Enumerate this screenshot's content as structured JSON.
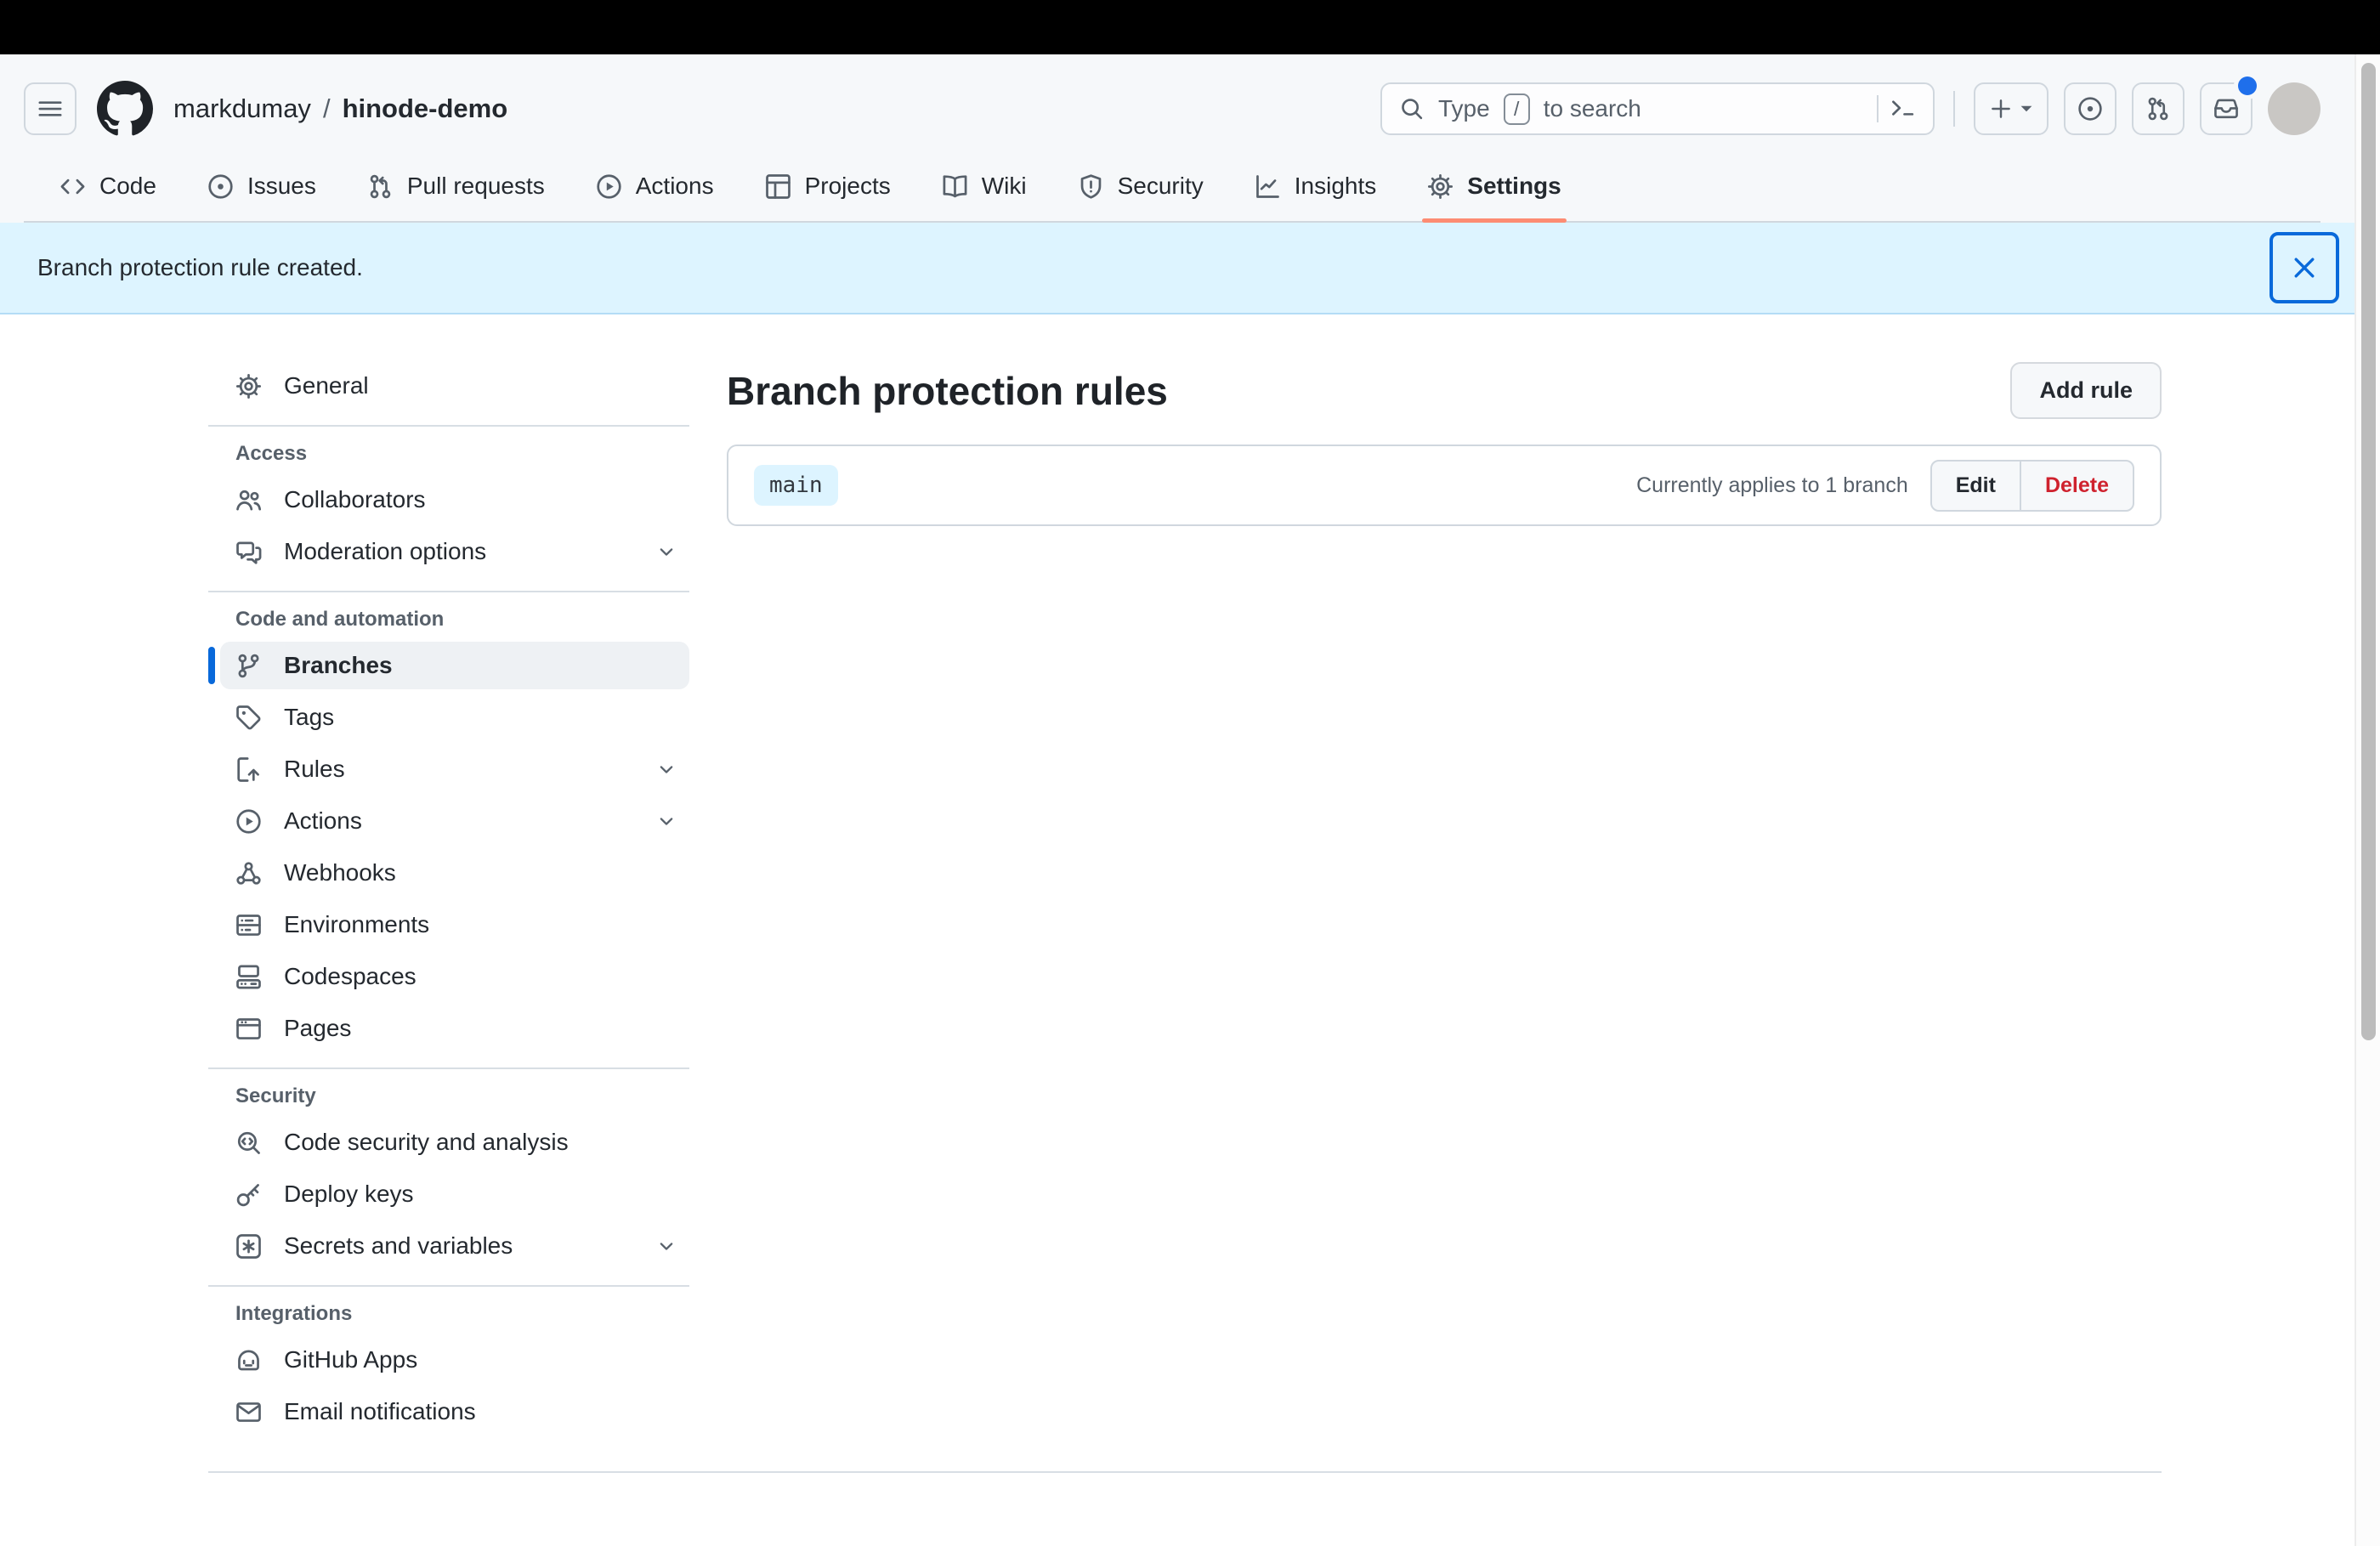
{
  "header": {
    "hamburger_icon": "three-bars-icon",
    "logo_icon": "github-mark-icon",
    "breadcrumb": {
      "owner": "markdumay",
      "separator": "/",
      "repo": "hinode-demo"
    },
    "search": {
      "prefix": "Type",
      "slash_key": "/",
      "suffix": "to search",
      "icons": [
        "search-icon",
        "command-palette-icon"
      ]
    },
    "actions": [
      {
        "name": "create-new",
        "icon": "plus-icon"
      },
      {
        "name": "issues",
        "icon": "issue-opened-icon"
      },
      {
        "name": "pull-requests",
        "icon": "git-pull-request-icon"
      },
      {
        "name": "inbox",
        "icon": "inbox-icon",
        "unread": true
      },
      {
        "name": "avatar",
        "icon": "user-avatar"
      }
    ]
  },
  "nav": {
    "tabs": [
      {
        "label": "Code",
        "icon": "code-icon",
        "active": false
      },
      {
        "label": "Issues",
        "icon": "issue-opened-icon",
        "active": false
      },
      {
        "label": "Pull requests",
        "icon": "git-pull-request-icon",
        "active": false
      },
      {
        "label": "Actions",
        "icon": "play-icon",
        "active": false
      },
      {
        "label": "Projects",
        "icon": "table-icon",
        "active": false
      },
      {
        "label": "Wiki",
        "icon": "book-icon",
        "active": false
      },
      {
        "label": "Security",
        "icon": "shield-icon",
        "active": false
      },
      {
        "label": "Insights",
        "icon": "graph-icon",
        "active": false
      },
      {
        "label": "Settings",
        "icon": "gear-icon",
        "active": true
      }
    ]
  },
  "banner": {
    "message": "Branch protection rule created.",
    "close_icon": "x-icon"
  },
  "sidebar": {
    "general": {
      "label": "General",
      "icon": "gear-icon"
    },
    "sections": [
      {
        "title": "Access",
        "items": [
          {
            "label": "Collaborators",
            "icon": "people-icon",
            "expandable": false
          },
          {
            "label": "Moderation options",
            "icon": "comment-discussion-icon",
            "expandable": true
          }
        ]
      },
      {
        "title": "Code and automation",
        "items": [
          {
            "label": "Branches",
            "icon": "git-branch-icon",
            "expandable": false,
            "active": true
          },
          {
            "label": "Tags",
            "icon": "tag-icon",
            "expandable": false
          },
          {
            "label": "Rules",
            "icon": "rules-icon",
            "expandable": true
          },
          {
            "label": "Actions",
            "icon": "play-icon",
            "expandable": true
          },
          {
            "label": "Webhooks",
            "icon": "webhook-icon",
            "expandable": false
          },
          {
            "label": "Environments",
            "icon": "server-icon",
            "expandable": false
          },
          {
            "label": "Codespaces",
            "icon": "codespaces-icon",
            "expandable": false
          },
          {
            "label": "Pages",
            "icon": "browser-icon",
            "expandable": false
          }
        ]
      },
      {
        "title": "Security",
        "items": [
          {
            "label": "Code security and analysis",
            "icon": "code-scan-icon",
            "expandable": false
          },
          {
            "label": "Deploy keys",
            "icon": "key-icon",
            "expandable": false
          },
          {
            "label": "Secrets and variables",
            "icon": "asterisk-box-icon",
            "expandable": true
          }
        ]
      },
      {
        "title": "Integrations",
        "items": [
          {
            "label": "GitHub Apps",
            "icon": "hubot-icon",
            "expandable": false
          },
          {
            "label": "Email notifications",
            "icon": "mail-icon",
            "expandable": false
          }
        ]
      }
    ]
  },
  "main": {
    "title": "Branch protection rules",
    "add_rule_button": "Add rule",
    "rules": [
      {
        "branch_pattern": "main",
        "applies_text": "Currently applies to 1 branch",
        "edit_button": "Edit",
        "delete_button": "Delete"
      }
    ]
  },
  "colors": {
    "accent_blue": "#0969da",
    "banner_bg": "#ddf4ff",
    "tab_underline": "#fd8c73",
    "delete_red": "#cf222e",
    "header_bg": "#f6f8fa",
    "border": "#d0d7de",
    "branch_badge_bg": "#ddf4ff",
    "unread_dot": "#1f6feb"
  }
}
